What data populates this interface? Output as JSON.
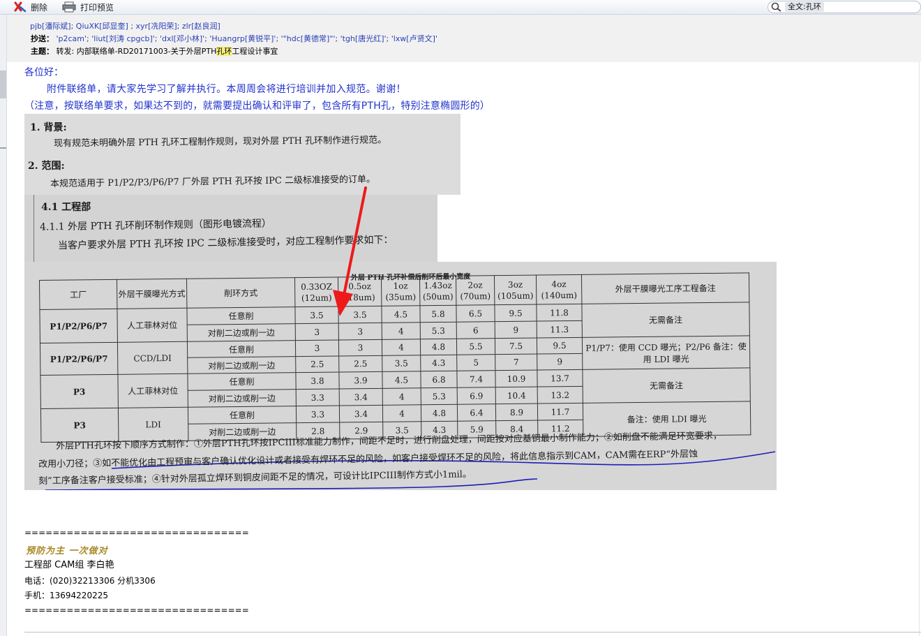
{
  "toolbar": {
    "delete_label": "删除",
    "print_preview_label": "打印预览",
    "search_chip": "全文:孔环"
  },
  "header": {
    "to_line": "pjb[潘际斌]; QiuXK[邱显奎] ; xyr[冼阳荣]; zlr[赵良润]",
    "cc_label": "抄送：",
    "cc_value": "'p2cam'; 'liut[刘涛 cpgcb]'; 'dxl[邓小林]'; 'Huangrp[黄锐平]'; '\"hdc[黄德常]\"'; 'tgh[唐光红]'; 'lxw[卢贤文]'",
    "subject_label": "主题：",
    "subject_prefix": "转发: 内部联络单-RD20171003-关于外层PTH",
    "subject_highlight": "孔环",
    "subject_suffix": "工程设计事宜"
  },
  "body": {
    "greeting": "各位好：",
    "para1": "附件联络单，请大家先学习了解并执行。本周周会将进行培训并加入规范。谢谢！",
    "para2": "（注意，按联络单要求，如果达不到的，就需要提出确认和评审了，包含所有PTH孔，特别注意椭圆形的）"
  },
  "scan": {
    "s1_h": "1.  背景:",
    "s1_t": "现有规范未明确外层 PTH 孔环工程制作规则，现对外层 PTH 孔环制作进行规范。",
    "s2_h": "2.  范围:",
    "s2_t": "本规范适用于 P1/P2/P3/P6/P7 厂外层 PTH 孔环按 IPC 二级标准接受的订单。",
    "s41": "4.1  工程部",
    "s411": "4.1.1  外层 PTH 孔环削环制作规则（图形电镀流程）",
    "s411b": "当客户要求外层 PTH 孔环按 IPC 二级标准接受时，对应工程制作要求如下：",
    "table_caption": "外层 PTH 孔环补偿后削环后最小宽度",
    "headers": [
      "工厂",
      "外层干膜曝光方式",
      "削环方式",
      "0.33OZ (12um)",
      "0.5oz (18um)",
      "1oz (35um)",
      "1.43oz (50um)",
      "2oz (70um)",
      "3oz (105um)",
      "4oz (140um)",
      "外层干膜曝光工序工程备注"
    ],
    "groups": [
      {
        "factory": "P1/P2/P6/P7",
        "method": "人工菲林对位",
        "note": "无需备注",
        "rows": [
          {
            "cut": "任意削",
            "v": [
              "3.5",
              "3.5",
              "4.5",
              "5.8",
              "6.5",
              "9.5",
              "11.8"
            ]
          },
          {
            "cut": "对削二边或削一边",
            "v": [
              "3",
              "3",
              "4",
              "5.3",
              "6",
              "9",
              "11.3"
            ]
          }
        ]
      },
      {
        "factory": "P1/P2/P6/P7",
        "method": "CCD/LDI",
        "note": "P1/P7：使用 CCD 曝光；P2/P6 备注：使用 LDI 曝光",
        "rows": [
          {
            "cut": "任意削",
            "v": [
              "3",
              "3",
              "4",
              "4.8",
              "5.5",
              "7.5",
              "9.5"
            ]
          },
          {
            "cut": "对削二边或削一边",
            "v": [
              "2.5",
              "2.5",
              "3.5",
              "4.3",
              "5",
              "7",
              "9"
            ]
          }
        ]
      },
      {
        "factory": "P3",
        "method": "人工菲林对位",
        "note": "无需备注",
        "rows": [
          {
            "cut": "任意削",
            "v": [
              "3.8",
              "3.9",
              "4.5",
              "6.8",
              "7.4",
              "10.9",
              "13.7"
            ]
          },
          {
            "cut": "对削二边或削一边",
            "v": [
              "3.3",
              "3.4",
              "4",
              "5.3",
              "6.9",
              "10.4",
              "13.2"
            ]
          }
        ]
      },
      {
        "factory": "P3",
        "method": "LDI",
        "note": "备注：使用 LDI 曝光",
        "rows": [
          {
            "cut": "任意削",
            "v": [
              "3.3",
              "3.4",
              "4",
              "4.8",
              "6.4",
              "8.9",
              "11.7"
            ]
          },
          {
            "cut": "对削二边或削一边",
            "v": [
              "2.8",
              "2.9",
              "3.5",
              "4.3",
              "5.9",
              "8.4",
              "11.2"
            ]
          }
        ]
      }
    ],
    "foot1": "外层PTH孔环按下顺序方式制作：①外层PTH孔环按IPCIII标准能力制作，间距不足时，进行削盘处理，间距按对应基铜最小制作能力；②如削盘不能满足环宽要求，",
    "foot2": "改用小刀径；③如不能优化由工程预审与客户确认优化设计或者接受有焊环不足的风险，如客户接受焊环不足的风险，将此信息指示到CAM，CAM需在ERP“外层蚀",
    "foot3": "刻”工序备注客户接受标准；④针对外层孤立焊环到铜皮间距不足的情况，可设计比IPCIII制作方式小1mil。"
  },
  "signature": {
    "divider": "================================",
    "motto": "预防为主 一次做对",
    "dept": "工程部 CAM组 李白艳",
    "phone": "电话：(020)32213306 分机3306",
    "mobile": "手机：13694220225"
  }
}
